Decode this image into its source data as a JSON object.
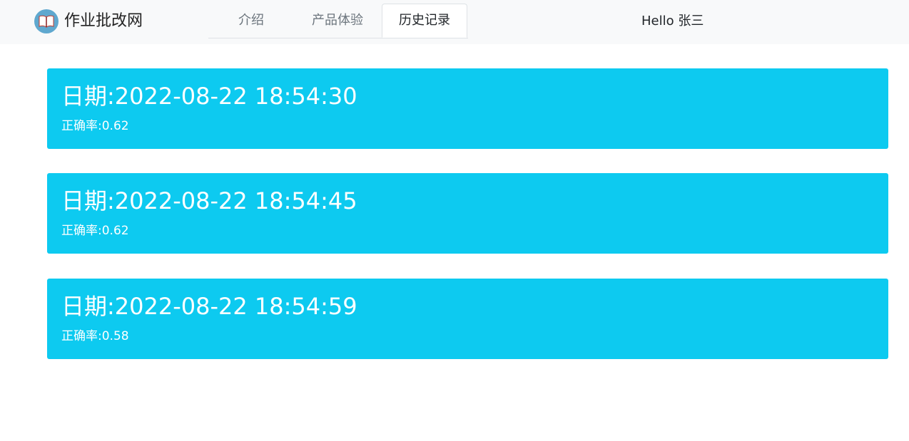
{
  "navbar": {
    "brand_icon": "open-book-icon",
    "brand_text": "作业批改网",
    "tabs": [
      {
        "label": "介绍",
        "active": false
      },
      {
        "label": "产品体验",
        "active": false
      },
      {
        "label": "历史记录",
        "active": true
      }
    ],
    "greeting": "Hello 张三"
  },
  "records": [
    {
      "date_label": "日期:2022-08-22 18:54:30",
      "accuracy_label": "正确率:0.62"
    },
    {
      "date_label": "日期:2022-08-22 18:54:45",
      "accuracy_label": "正确率:0.62"
    },
    {
      "date_label": "日期:2022-08-22 18:54:59",
      "accuracy_label": "正确率:0.58"
    }
  ],
  "colors": {
    "navbar_bg": "#f8f9fa",
    "record_bg": "#0dcaf0",
    "logo_bg": "#5fa8cf"
  }
}
